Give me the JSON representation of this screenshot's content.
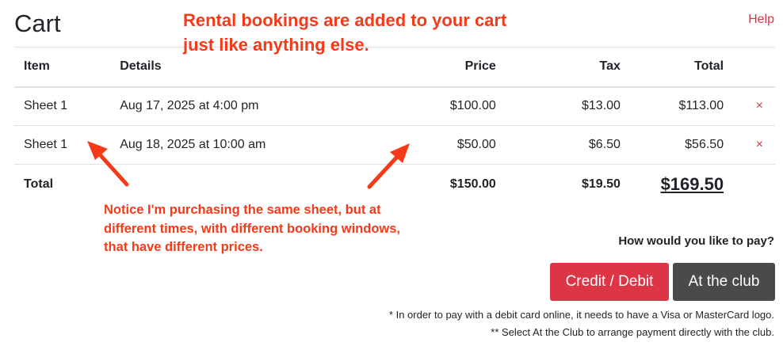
{
  "page": {
    "title": "Cart",
    "help_label": "Help"
  },
  "table": {
    "headers": {
      "item": "Item",
      "details": "Details",
      "price": "Price",
      "tax": "Tax",
      "total": "Total"
    },
    "rows": [
      {
        "item": "Sheet 1",
        "details": "Aug 17, 2025 at 4:00 pm",
        "price": "$100.00",
        "tax": "$13.00",
        "total": "$113.00",
        "remove": "×"
      },
      {
        "item": "Sheet 1",
        "details": "Aug 18, 2025 at 10:00 am",
        "price": "$50.00",
        "tax": "$6.50",
        "total": "$56.50",
        "remove": "×"
      }
    ],
    "footer": {
      "label": "Total",
      "price": "$150.00",
      "tax": "$19.50",
      "total": "$169.50"
    }
  },
  "payment": {
    "question": "How would you like to pay?",
    "credit_label": "Credit / Debit",
    "club_label": "At the club",
    "note1": "* In order to pay with a debit card online, it needs to have a Visa or MasterCard logo.",
    "note2": "** Select At the Club to arrange payment directly with the club."
  },
  "annotations": {
    "top": "Rental bookings are added to your cart just like anything else.",
    "bottom": "Notice I'm purchasing the same sheet, but at different times, with different booking windows, that have different prices."
  },
  "colors": {
    "accent": "#dc3545",
    "dark_button": "#4a4a4a",
    "annotation": "#f53a19"
  }
}
